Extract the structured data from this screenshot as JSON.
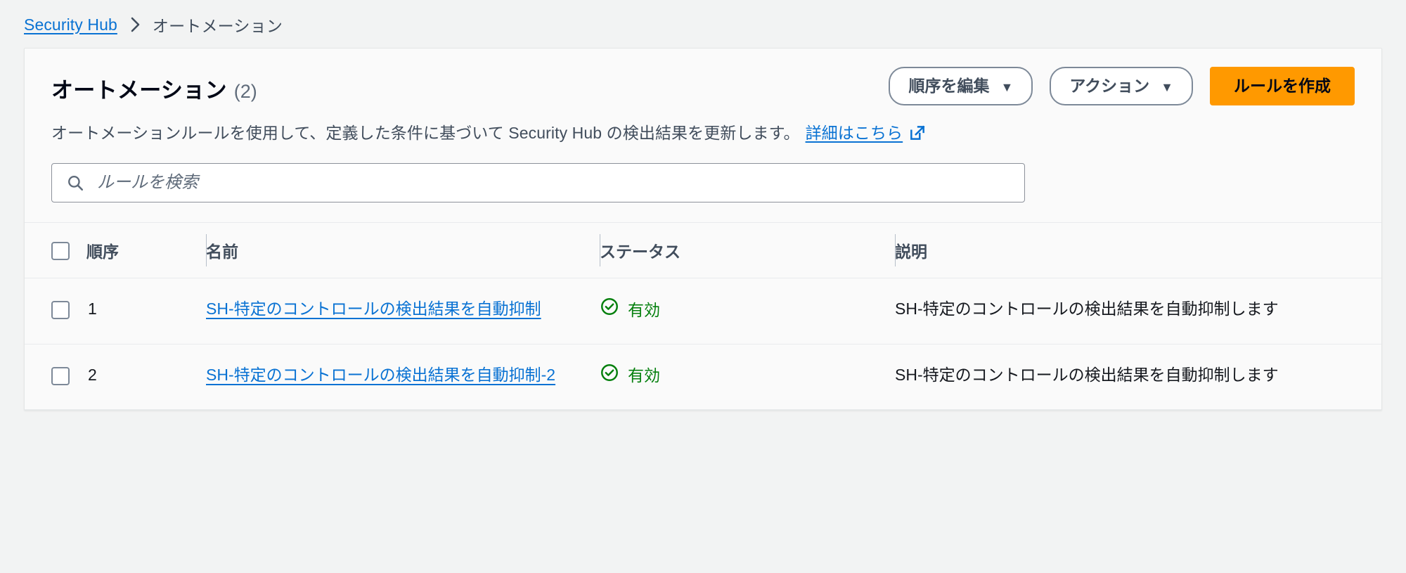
{
  "breadcrumb": {
    "root_label": "Security Hub",
    "separator": "›",
    "current_label": "オートメーション"
  },
  "header": {
    "title": "オートメーション",
    "count": "(2)",
    "description_text": "オートメーションルールを使用して、定義した条件に基づいて Security Hub の検出結果を更新します。",
    "description_link": "詳細はこちら",
    "external_link_icon": "external-link-icon"
  },
  "toolbar": {
    "edit_order_label": "順序を編集",
    "edit_order_caret": "▼",
    "actions_label": "アクション",
    "actions_caret": "▼",
    "create_rule_label": "ルールを作成",
    "primary_color": "#ff9900"
  },
  "search": {
    "icon": "search-icon",
    "placeholder": "ルールを検索",
    "value": ""
  },
  "table": {
    "columns": [
      {
        "key": "select",
        "label": ""
      },
      {
        "key": "order",
        "label": "順序"
      },
      {
        "key": "name",
        "label": "名前"
      },
      {
        "key": "status",
        "label": "ステータス"
      },
      {
        "key": "description",
        "label": "説明"
      }
    ],
    "rows": [
      {
        "order": "1",
        "name": "SH-特定のコントロールの検出結果を自動抑制",
        "status": "有効",
        "status_icon": "check-circle-icon",
        "status_color": "#037f0c",
        "description": "SH-特定のコントロールの検出結果を自動抑制します"
      },
      {
        "order": "2",
        "name": "SH-特定のコントロールの検出結果を自動抑制-2",
        "status": "有効",
        "status_icon": "check-circle-icon",
        "status_color": "#037f0c",
        "description": "SH-特定のコントロールの検出結果を自動抑制します"
      }
    ]
  },
  "colors": {
    "page_background": "#f2f3f3",
    "card_background": "#fafafa",
    "link": "#0972d3",
    "accent": "#ff9900",
    "success": "#037f0c",
    "text": "#16191f",
    "muted_text": "#414d5c"
  }
}
